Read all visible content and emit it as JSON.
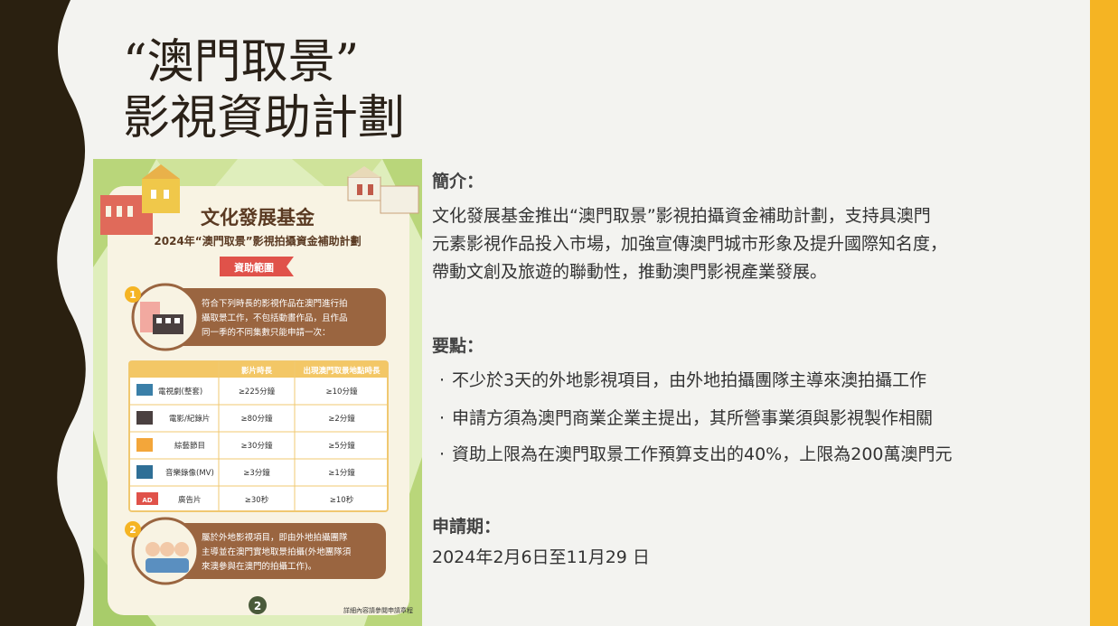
{
  "slide": {
    "title_line1": "“澳門取景”",
    "title_line2": "影視資助計劃"
  },
  "poster": {
    "org": "文化發展基金",
    "subtitle": "2024年“澳門取景”影視拍攝資金補助計劃",
    "ribbon": "資助範圍",
    "item1_number": "1",
    "item1_text_line1": "符合下列時長的影視作品在澳門進行拍",
    "item1_text_line2": "攝取景工作，不包括動畫作品，且作品",
    "item1_text_line3": "同一季的不同集數只能申請一次：",
    "table_headers": [
      "",
      "影片時長",
      "出現澳門取景地點時長"
    ],
    "table_rows": [
      {
        "type": "電視劇(整套)",
        "duration": "≥225分鐘",
        "macau": "≥10分鐘",
        "icon": "tv-icon"
      },
      {
        "type": "電影/紀錄片",
        "duration": "≥80分鐘",
        "macau": "≥2分鐘",
        "icon": "film-clapper-icon"
      },
      {
        "type": "綜藝節目",
        "duration": "≥30分鐘",
        "macau": "≥5分鐘",
        "icon": "variety-show-icon"
      },
      {
        "type": "音樂錄像(MV)",
        "duration": "≥3分鐘",
        "macau": "≥1分鐘",
        "icon": "music-video-icon"
      },
      {
        "type": "廣告片",
        "duration": "≥30秒",
        "macau": "≥10秒",
        "icon": "advertisement-icon"
      }
    ],
    "ad_badge": "AD",
    "item2_number": "2",
    "item2_text_line1": "屬於外地影視項目，即由外地拍攝團隊",
    "item2_text_line2": "主導並在澳門實地取景拍攝(外地團隊須",
    "item2_text_line3": "來澳參與在澳門的拍攝工作)。",
    "page_number": "2",
    "footer_note": "詳細內容請參閱申請章程"
  },
  "content": {
    "intro_heading": "簡介：",
    "intro_line1": "文化發展基金推出“澳門取景”影視拍攝資金補助計劃，支持具澳門",
    "intro_line2": "元素影視作品投入市場，加強宣傳澳門城市形象及提升國際知名度，",
    "intro_line3": "帶動文創及旅遊的聯動性，推動澳門影視產業發展。",
    "points_heading": "要點：",
    "bullet_symbol": "·",
    "points": [
      "不少於3天的外地影視項目，由外地拍攝團隊主導來澳拍攝工作",
      "申請方須為澳門商業企業主提出，其所營事業須與影視製作相關",
      "資助上限為在澳門取景工作預算支出的40%，上限為200萬澳門元"
    ],
    "period_heading": "申請期：",
    "period_text": "2024年2月6日至11月29 日"
  },
  "colors": {
    "left_band": "#2a2010",
    "right_band": "#f5b423",
    "background": "#f3f3f0",
    "accent_brown": "#9a6540",
    "poster_green": "#a8cc6a",
    "ribbon_red": "#e0524a"
  }
}
